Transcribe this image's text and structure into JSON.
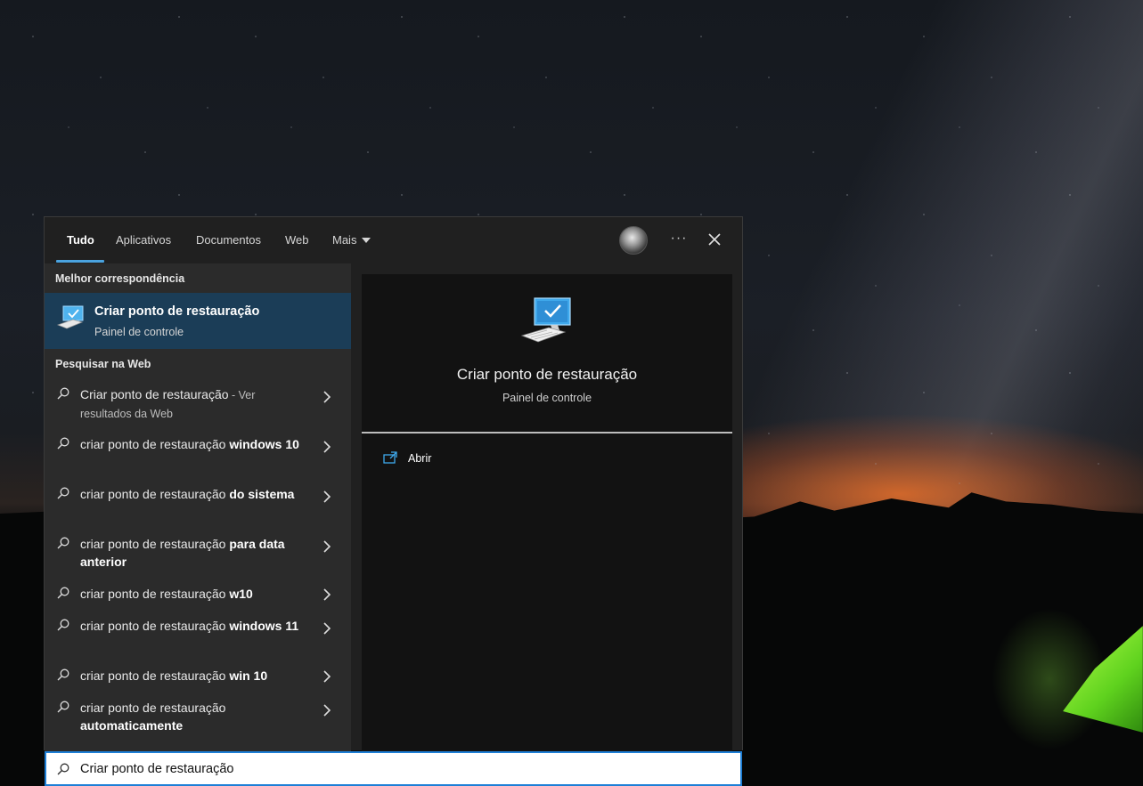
{
  "tabs": [
    {
      "label": "Tudo",
      "active": true
    },
    {
      "label": "Aplicativos"
    },
    {
      "label": "Documentos"
    },
    {
      "label": "Web"
    },
    {
      "label": "Mais"
    }
  ],
  "header_actions": {
    "more_icon": "ellipsis-icon",
    "close_icon": "close-icon"
  },
  "best_match": {
    "heading": "Melhor correspondência",
    "title": "Criar ponto de restauração",
    "subtitle": "Painel de controle",
    "icon": "computer-check-icon"
  },
  "web_search": {
    "heading": "Pesquisar na Web",
    "results": [
      {
        "base": "Criar ponto de restauração",
        "bold": "",
        "suffix": " - Ver",
        "suffix2": "resultados da Web"
      },
      {
        "base": "criar ponto de restauração ",
        "bold": "windows 10"
      },
      {
        "base": "criar ponto de restauração ",
        "bold": "do sistema"
      },
      {
        "base": "criar ponto de restauração ",
        "bold": "para data anterior"
      },
      {
        "base": "criar ponto de restauração ",
        "bold": "w10"
      },
      {
        "base": "criar ponto de restauração ",
        "bold": "windows 11"
      },
      {
        "base": "criar ponto de restauração ",
        "bold": "win 10"
      },
      {
        "base": "criar ponto de restauração ",
        "bold": "automaticamente"
      }
    ]
  },
  "preview": {
    "title": "Criar ponto de restauração",
    "subtitle": "Painel de controle",
    "action_label": "Abrir",
    "action_icon": "open-icon"
  },
  "search": {
    "value": "Criar ponto de restauração",
    "icon": "search-icon"
  },
  "colors": {
    "accent": "#1e7fd6",
    "selected_bg": "#1b3d57",
    "panel_bg": "#202020"
  }
}
